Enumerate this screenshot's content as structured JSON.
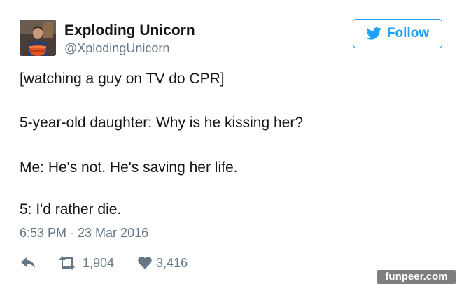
{
  "tweet": {
    "author": {
      "display_name": "Exploding Unicorn",
      "handle": "@XplodingUnicorn"
    },
    "follow_label": "Follow",
    "lines": [
      "[watching a guy on TV do CPR]",
      "5-year-old daughter: Why is he kissing her?",
      "Me: He's not. He's saving her life.",
      "5: I'd rather die."
    ],
    "timestamp": "6:53 PM - 23 Mar 2016",
    "retweets": "1,904",
    "likes": "3,416"
  },
  "watermark": "funpeer.com",
  "colors": {
    "accent": "#1da1f2",
    "text": "#14171a",
    "muted": "#657786",
    "watermark_bg": "#7e7e7e"
  },
  "icons": {
    "follow": "bird-icon",
    "reply": "reply-arrow-icon",
    "retweet": "retweet-icon",
    "like": "heart-icon"
  }
}
